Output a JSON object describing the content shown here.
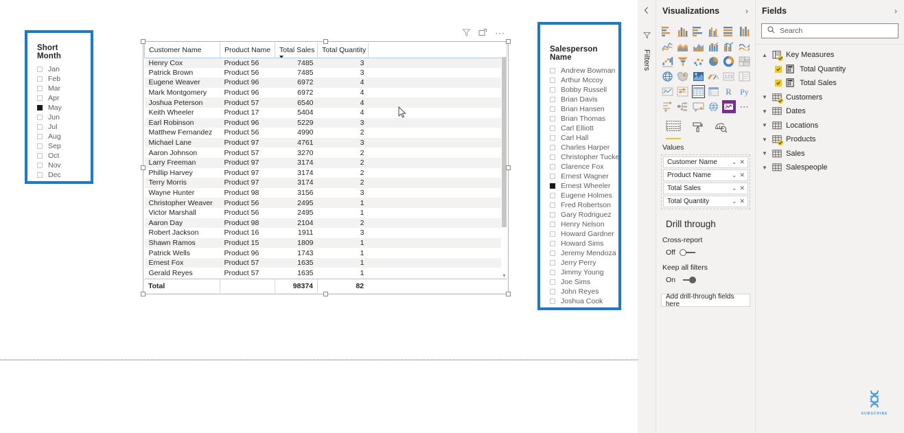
{
  "month_slicer": {
    "title": "Short Month",
    "items": [
      {
        "label": "Jan",
        "selected": false
      },
      {
        "label": "Feb",
        "selected": false
      },
      {
        "label": "Mar",
        "selected": false
      },
      {
        "label": "Apr",
        "selected": false
      },
      {
        "label": "May",
        "selected": true
      },
      {
        "label": "Jun",
        "selected": false
      },
      {
        "label": "Jul",
        "selected": false
      },
      {
        "label": "Aug",
        "selected": false
      },
      {
        "label": "Sep",
        "selected": false
      },
      {
        "label": "Oct",
        "selected": false
      },
      {
        "label": "Nov",
        "selected": false
      },
      {
        "label": "Dec",
        "selected": false
      }
    ]
  },
  "salesperson_slicer": {
    "title": "Salesperson Name",
    "items": [
      {
        "label": "Andrew Bowman",
        "selected": false
      },
      {
        "label": "Arthur Mccoy",
        "selected": false
      },
      {
        "label": "Bobby Russell",
        "selected": false
      },
      {
        "label": "Brian Davis",
        "selected": false
      },
      {
        "label": "Brian Hansen",
        "selected": false
      },
      {
        "label": "Brian Thomas",
        "selected": false
      },
      {
        "label": "Carl Elliott",
        "selected": false
      },
      {
        "label": "Carl Hall",
        "selected": false
      },
      {
        "label": "Charles Harper",
        "selected": false
      },
      {
        "label": "Christopher Tucker",
        "selected": false
      },
      {
        "label": "Clarence Fox",
        "selected": false
      },
      {
        "label": "Ernest Wagner",
        "selected": false
      },
      {
        "label": "Ernest Wheeler",
        "selected": true
      },
      {
        "label": "Eugene Holmes",
        "selected": false
      },
      {
        "label": "Fred Robertson",
        "selected": false
      },
      {
        "label": "Gary Rodriguez",
        "selected": false
      },
      {
        "label": "Henry Nelson",
        "selected": false
      },
      {
        "label": "Howard Gardner",
        "selected": false
      },
      {
        "label": "Howard Sims",
        "selected": false
      },
      {
        "label": "Jeremy Mendoza",
        "selected": false
      },
      {
        "label": "Jerry Perry",
        "selected": false
      },
      {
        "label": "Jimmy Young",
        "selected": false
      },
      {
        "label": "Joe Sims",
        "selected": false
      },
      {
        "label": "John Reyes",
        "selected": false
      },
      {
        "label": "Joshua Cook",
        "selected": false
      }
    ]
  },
  "table_visual": {
    "columns": [
      "Customer Name",
      "Product Name",
      "Total Sales",
      "Total Quantity"
    ],
    "sort_column": "Total Sales",
    "sort_direction": "descending",
    "rows": [
      [
        "Henry Cox",
        "Product 56",
        "7485",
        "3"
      ],
      [
        "Patrick Brown",
        "Product 56",
        "7485",
        "3"
      ],
      [
        "Eugene Weaver",
        "Product 96",
        "6972",
        "4"
      ],
      [
        "Mark Montgomery",
        "Product 96",
        "6972",
        "4"
      ],
      [
        "Joshua Peterson",
        "Product 57",
        "6540",
        "4"
      ],
      [
        "Keith Wheeler",
        "Product 17",
        "5404",
        "4"
      ],
      [
        "Earl Robinson",
        "Product 96",
        "5229",
        "3"
      ],
      [
        "Matthew Fernandez",
        "Product 56",
        "4990",
        "2"
      ],
      [
        "Michael Lane",
        "Product 97",
        "4761",
        "3"
      ],
      [
        "Aaron Johnson",
        "Product 57",
        "3270",
        "2"
      ],
      [
        "Larry Freeman",
        "Product 97",
        "3174",
        "2"
      ],
      [
        "Phillip Harvey",
        "Product 97",
        "3174",
        "2"
      ],
      [
        "Terry Morris",
        "Product 97",
        "3174",
        "2"
      ],
      [
        "Wayne Hunter",
        "Product 98",
        "3156",
        "3"
      ],
      [
        "Christopher Weaver",
        "Product 56",
        "2495",
        "1"
      ],
      [
        "Victor Marshall",
        "Product 56",
        "2495",
        "1"
      ],
      [
        "Aaron Day",
        "Product 98",
        "2104",
        "2"
      ],
      [
        "Robert Jackson",
        "Product 16",
        "1911",
        "3"
      ],
      [
        "Shawn Ramos",
        "Product 15",
        "1809",
        "1"
      ],
      [
        "Patrick Wells",
        "Product 96",
        "1743",
        "1"
      ],
      [
        "Ernest Fox",
        "Product 57",
        "1635",
        "1"
      ],
      [
        "Gerald Reyes",
        "Product 57",
        "1635",
        "1"
      ]
    ],
    "total_row": {
      "label": "Total",
      "product": "",
      "total_sales": "98374",
      "total_quantity": "82"
    },
    "header_icons": [
      "filter-icon",
      "focus-mode-icon",
      "more-options-icon"
    ]
  },
  "filters_rail": {
    "label": "Filters",
    "collapse_icon": "chevron-left-icon",
    "funnel_icon": "filter-icon"
  },
  "visualizations_pane": {
    "title": "Visualizations",
    "expand_icon": "chevron-right-icon",
    "selected_visual": "table-visual-icon",
    "format_tabs": [
      {
        "name": "fields-tab",
        "icon": "fields-table-icon",
        "active": true
      },
      {
        "name": "format-tab",
        "icon": "paint-roller-icon",
        "active": false
      },
      {
        "name": "analytics-tab",
        "icon": "magnifier-icon",
        "active": false
      }
    ],
    "values_label": "Values",
    "value_fields": [
      "Customer Name",
      "Product Name",
      "Total Sales",
      "Total Quantity"
    ],
    "drill_through": {
      "title": "Drill through",
      "cross_report_label": "Cross-report",
      "cross_report_state": "Off",
      "keep_filters_label": "Keep all filters",
      "keep_filters_state": "On",
      "drop_zone": "Add drill-through fields here"
    }
  },
  "fields_pane": {
    "title": "Fields",
    "expand_icon": "chevron-right-icon",
    "search_placeholder": "Search",
    "search_value": "",
    "items": [
      {
        "label": "Key Measures",
        "type": "folder",
        "expanded": true,
        "checked": true,
        "badge": true
      },
      {
        "label": "Total Quantity",
        "type": "measure",
        "child": true,
        "checked": true
      },
      {
        "label": "Total Sales",
        "type": "measure",
        "child": true,
        "checked": true
      },
      {
        "label": "Customers",
        "type": "table",
        "expanded": false,
        "badge": true
      },
      {
        "label": "Dates",
        "type": "table",
        "expanded": false,
        "badge": false
      },
      {
        "label": "Locations",
        "type": "table",
        "expanded": false,
        "badge": false
      },
      {
        "label": "Products",
        "type": "table",
        "expanded": false,
        "badge": true
      },
      {
        "label": "Sales",
        "type": "table",
        "expanded": false,
        "badge": false
      },
      {
        "label": "Salespeople",
        "type": "table",
        "expanded": false,
        "badge": false
      }
    ]
  },
  "watermark": {
    "text": "SUBSCRIBE",
    "icon": "dna-helix-icon"
  },
  "colors": {
    "slicer_border": "#1A7BCB",
    "accent_yellow": "#F2C811",
    "chart_orange": "#E8942C",
    "chart_blue": "#5B8DB8",
    "pane_bg": "#F3F2F1",
    "text": "#252423"
  }
}
